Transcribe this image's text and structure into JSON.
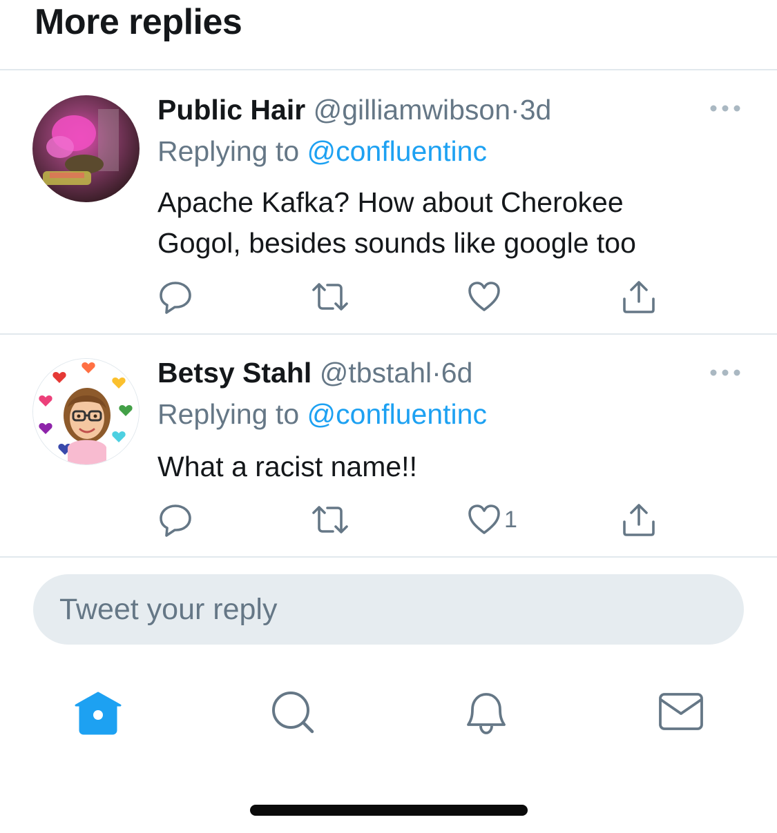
{
  "section": {
    "title": "More replies"
  },
  "tweets": [
    {
      "display_name": "Public Hair",
      "handle": "@gilliamwibson",
      "separator": "·",
      "time": "3d",
      "replying_label": "Replying to",
      "replying_to": "@confluentinc",
      "text_line1": "Apache Kafka? How about Cherokee",
      "text_line2": "Gogol, besides sounds like google too",
      "like_count": "",
      "avatar_icon": "avatar-photo"
    },
    {
      "display_name": "Betsy Stahl",
      "handle": "@tbstahl",
      "separator": "·",
      "time": "6d",
      "replying_label": "Replying to",
      "replying_to": "@confluentinc",
      "text_line1": "What a racist name!!",
      "text_line2": "",
      "like_count": "1",
      "avatar_icon": "avatar-bitmoji"
    }
  ],
  "actions": {
    "icons": [
      "reply-icon",
      "retweet-icon",
      "like-icon",
      "share-icon"
    ]
  },
  "composer": {
    "placeholder": "Tweet your reply"
  },
  "tabbar": {
    "icons": [
      "home-icon",
      "search-icon",
      "notifications-icon",
      "messages-icon"
    ],
    "active": "home-icon"
  },
  "colors": {
    "accent": "#1da1f2",
    "text_primary": "#14171a",
    "text_secondary": "#657786",
    "divider": "#e1e8ed",
    "input_bg": "#e6ecf0"
  }
}
